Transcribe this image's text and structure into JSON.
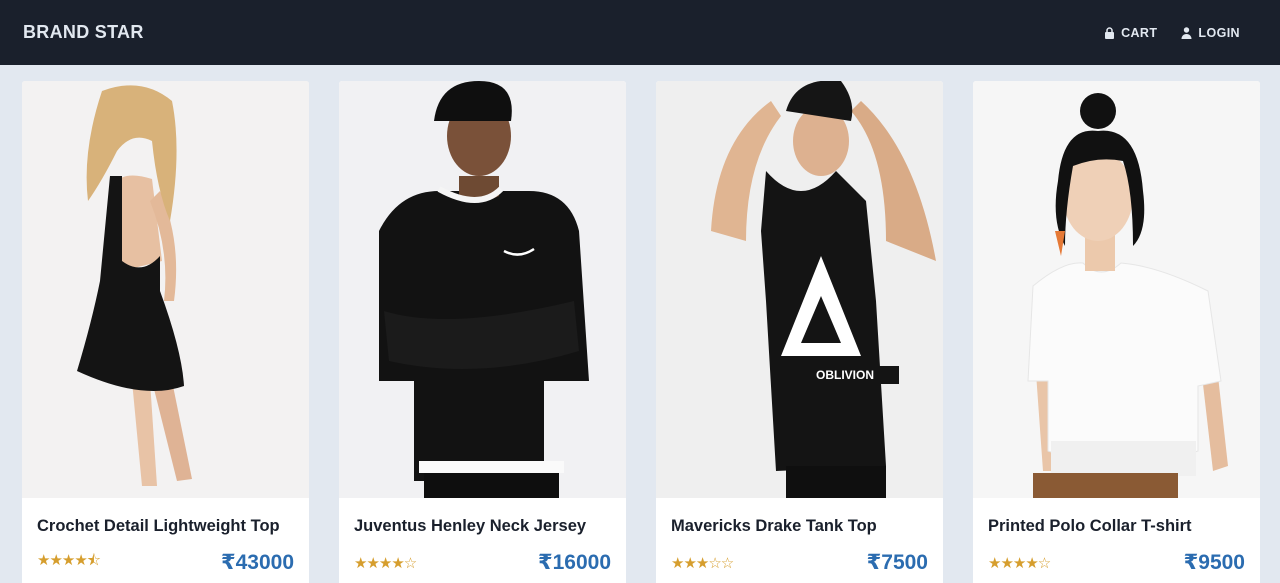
{
  "navbar": {
    "brand": "BRAND STAR",
    "cart_label": "CART",
    "login_label": "LOGIN"
  },
  "products": [
    {
      "title": "Crochet Detail Lightweight Top",
      "stars": "★★★★⯪",
      "rating": 4.5,
      "price": "₹43000",
      "image_icon": "woman-black-dress-photo"
    },
    {
      "title": "Juventus Henley Neck Jersey",
      "stars": "★★★★☆",
      "rating": 4,
      "price": "₹16000",
      "image_icon": "man-black-sweater-photo"
    },
    {
      "title": "Mavericks Drake Tank Top",
      "stars": "★★★☆☆",
      "rating": 3,
      "price": "₹7500",
      "image_icon": "man-black-tank-photo"
    },
    {
      "title": "Printed Polo Collar T-shirt",
      "stars": "★★★★☆",
      "rating": 4,
      "price": "₹9500",
      "image_icon": "woman-white-tshirt-photo"
    }
  ],
  "colors": {
    "navbar_bg": "#1a202c",
    "page_bg": "#e2e8f0",
    "star": "#d69e2e",
    "price": "#2b6cb0"
  }
}
